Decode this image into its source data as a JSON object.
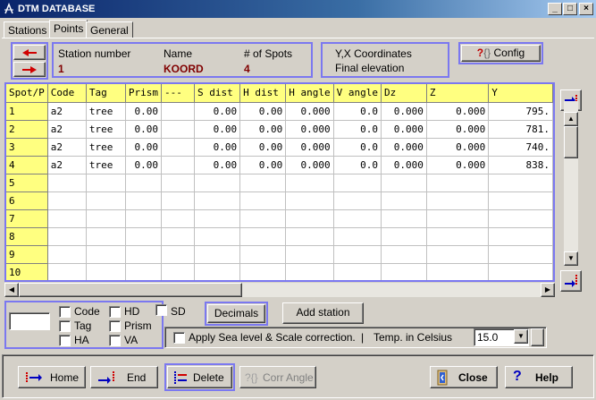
{
  "window": {
    "title": "DTM DATABASE"
  },
  "tabs": [
    {
      "label": "Stations"
    },
    {
      "label": "Points"
    },
    {
      "label": "General"
    }
  ],
  "station_info": {
    "station_number_label": "Station number",
    "station_number": "1",
    "name_label": "Name",
    "name": "KOORD",
    "spots_label": "# of Spots",
    "spots": "4"
  },
  "coords_info": {
    "line1": "Y,X Coordinates",
    "line2": "Final elevation"
  },
  "config_label": "Config",
  "grid": {
    "columns": [
      "Spot/P",
      "Code",
      "Tag",
      "Prism",
      "---",
      "S dist",
      "H dist",
      "H angle",
      "V angle",
      "Dz",
      "Z",
      "Y"
    ],
    "rows": [
      {
        "n": "1",
        "code": "a2",
        "tag": "tree",
        "prism": "0.00",
        "dash": "",
        "sdist": "0.00",
        "hdist": "0.00",
        "hangle": "0.000",
        "vangle": "0.0",
        "dz": "0.000",
        "z": "0.000",
        "y": "795."
      },
      {
        "n": "2",
        "code": "a2",
        "tag": "tree",
        "prism": "0.00",
        "dash": "",
        "sdist": "0.00",
        "hdist": "0.00",
        "hangle": "0.000",
        "vangle": "0.0",
        "dz": "0.000",
        "z": "0.000",
        "y": "781."
      },
      {
        "n": "3",
        "code": "a2",
        "tag": "tree",
        "prism": "0.00",
        "dash": "",
        "sdist": "0.00",
        "hdist": "0.00",
        "hangle": "0.000",
        "vangle": "0.0",
        "dz": "0.000",
        "z": "0.000",
        "y": "740."
      },
      {
        "n": "4",
        "code": "a2",
        "tag": "tree",
        "prism": "0.00",
        "dash": "",
        "sdist": "0.00",
        "hdist": "0.00",
        "hangle": "0.000",
        "vangle": "0.0",
        "dz": "0.000",
        "z": "0.000",
        "y": "838."
      }
    ],
    "empty_rows": [
      "5",
      "6",
      "7",
      "8",
      "9",
      "10"
    ]
  },
  "options": {
    "checkboxes": [
      "Code",
      "Tag",
      "HA",
      "HD",
      "Prism",
      "VA",
      "SD"
    ],
    "decimals_label": "Decimals",
    "add_station_label": "Add station",
    "sea_level_label": "Apply Sea level & Scale correction.",
    "separator": "|",
    "temp_label": "Temp. in Celsius",
    "temp_value": "15.0"
  },
  "bottom_buttons": {
    "home": "Home",
    "end": "End",
    "delete": "Delete",
    "corr_angle": "Corr Angle",
    "close": "Close",
    "help": "Help"
  },
  "colors": {
    "grid_header": "#ffff80",
    "accent_border": "#7b78f0",
    "value_text": "#800000"
  }
}
